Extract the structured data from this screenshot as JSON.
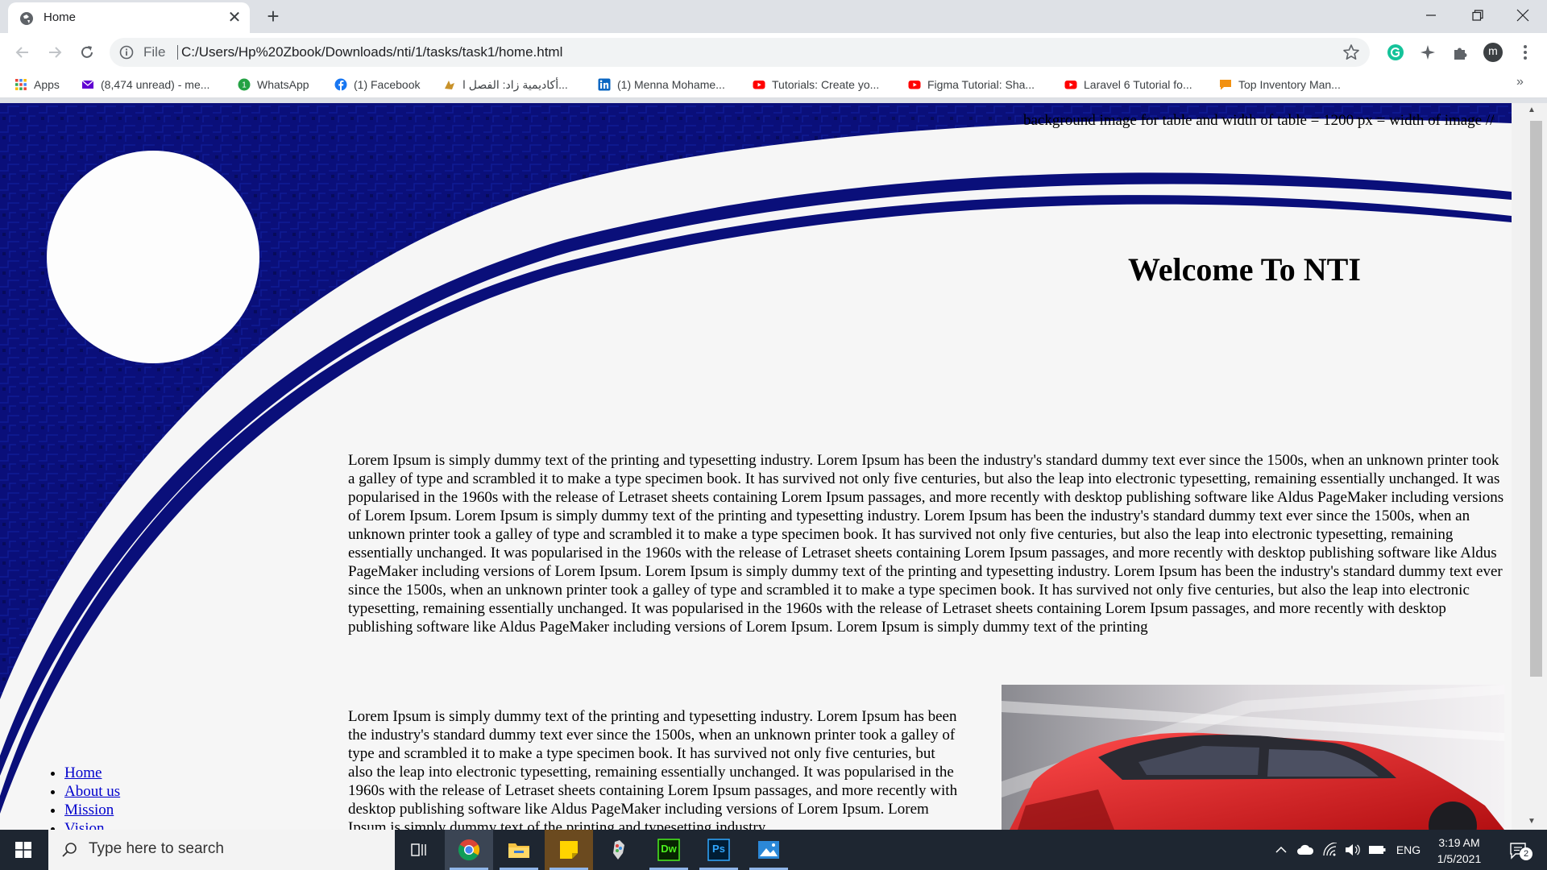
{
  "tab": {
    "title": "Home",
    "close_glyph": "✕",
    "new_tab_glyph": "+"
  },
  "toolbar": {
    "file_label": "File",
    "url": "C:/Users/Hp%20Zbook/Downloads/nti/1/tasks/task1/home.html",
    "profile_initial": "m"
  },
  "bookmarks": [
    {
      "label": "Apps",
      "icon": "apps-grid-icon"
    },
    {
      "label": "(8,474 unread) - me...",
      "icon": "mail-icon"
    },
    {
      "label": "WhatsApp",
      "icon": "whatsapp-icon"
    },
    {
      "label": "(1) Facebook",
      "icon": "facebook-icon"
    },
    {
      "label": "أكاديمية زاد: الفصل ا...",
      "icon": "zad-icon"
    },
    {
      "label": "(1) Menna Mohame...",
      "icon": "linkedin-icon"
    },
    {
      "label": "Tutorials: Create yo...",
      "icon": "youtube-icon"
    },
    {
      "label": "Figma Tutorial: Sha...",
      "icon": "youtube-icon"
    },
    {
      "label": "Laravel 6 Tutorial fo...",
      "icon": "youtube-icon"
    },
    {
      "label": "Top Inventory Man...",
      "icon": "chat-icon"
    }
  ],
  "bookmarks_more": "»",
  "page": {
    "note": "background image for table and width of table = 1200 px = width of image //",
    "heading": "Welcome To NTI",
    "paragraph1": "Lorem Ipsum is simply dummy text of the printing and typesetting industry. Lorem Ipsum has been the industry's standard dummy text ever since the 1500s, when an unknown printer took a galley of type and scrambled it to make a type specimen book. It has survived not only five centuries, but also the leap into electronic typesetting, remaining essentially unchanged. It was popularised in the 1960s with the release of Letraset sheets containing Lorem Ipsum passages, and more recently with desktop publishing software like Aldus PageMaker including versions of Lorem Ipsum. Lorem Ipsum is simply dummy text of the printing and typesetting industry. Lorem Ipsum has been the industry's standard dummy text ever since the 1500s, when an unknown printer took a galley of type and scrambled it to make a type specimen book. It has survived not only five centuries, but also the leap into electronic typesetting, remaining essentially unchanged. It was popularised in the 1960s with the release of Letraset sheets containing Lorem Ipsum passages, and more recently with desktop publishing software like Aldus PageMaker including versions of Lorem Ipsum. Lorem Ipsum is simply dummy text of the printing and typesetting industry. Lorem Ipsum has been the industry's standard dummy text ever since the 1500s, when an unknown printer took a galley of type and scrambled it to make a type specimen book. It has survived not only five centuries, but also the leap into electronic typesetting, remaining essentially unchanged. It was popularised in the 1960s with the release of Letraset sheets containing Lorem Ipsum passages, and more recently with desktop publishing software like Aldus PageMaker including versions of Lorem Ipsum. Lorem Ipsum is simply dummy text of the printing",
    "paragraph2": "Lorem Ipsum is simply dummy text of the printing and typesetting industry. Lorem Ipsum has been the industry's standard dummy text ever since the 1500s, when an unknown printer took a galley of type and scrambled it to make a type specimen book. It has survived not only five centuries, but also the leap into electronic typesetting, remaining essentially unchanged. It was popularised in the 1960s with the release of Letraset sheets containing Lorem Ipsum passages, and more recently with desktop publishing software like Aldus PageMaker including versions of Lorem Ipsum. Lorem Ipsum is simply dummy text of the printing and typesetting industry.",
    "nav_links": [
      "Home",
      "About us",
      "Mission",
      "Vision"
    ]
  },
  "taskbar": {
    "search_placeholder": "Type here to search",
    "apps": [
      "task-view-icon",
      "chrome-icon",
      "file-explorer-icon",
      "sticky-notes-icon",
      "paint-icon",
      "dreamweaver-icon",
      "photoshop-icon",
      "photos-icon"
    ],
    "dreamweaver_label": "Dw",
    "photoshop_label": "Ps",
    "language": "ENG",
    "time": "3:19 AM",
    "date": "1/5/2021",
    "notification_count": "2"
  },
  "colors": {
    "page_bg": "#f6f6f6",
    "swoosh": "#0a0f7a",
    "link": "#0000cc",
    "taskbar": "#1e2631"
  }
}
